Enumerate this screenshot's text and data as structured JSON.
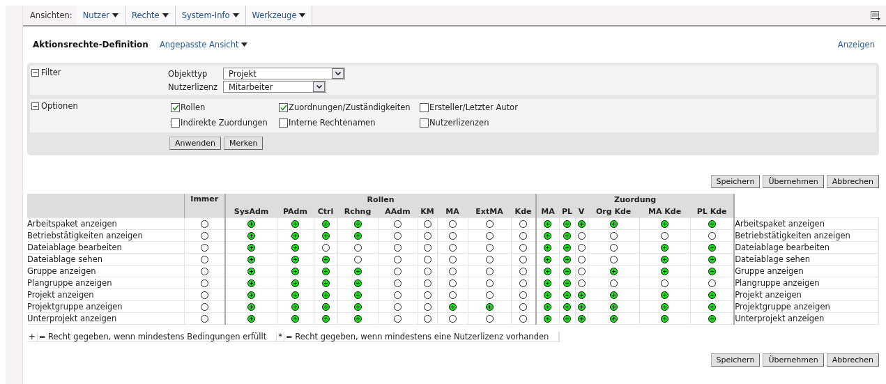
{
  "menu": {
    "label": "Ansichten:",
    "items": [
      "Nutzer",
      "Rechte",
      "System-Info",
      "Werkzeuge"
    ]
  },
  "header": {
    "title": "Aktionsrechte-Definition",
    "view": "Angepasste Ansicht",
    "action": "Anzeigen"
  },
  "filter": {
    "title": "Filter",
    "expanded": true,
    "fields": [
      {
        "label": "Objekttyp",
        "value": "Projekt"
      },
      {
        "label": "Nutzerlizenz",
        "value": "Mitarbeiter"
      }
    ]
  },
  "options": {
    "title": "Optionen",
    "expanded": true,
    "items": [
      {
        "label": "Rollen",
        "checked": true
      },
      {
        "label": "Zuordnungen/Zuständigkeiten",
        "checked": true
      },
      {
        "label": "Ersteller/Letzter Autor",
        "checked": false
      },
      {
        "label": "Indirekte Zuordungen",
        "checked": false
      },
      {
        "label": "Interne Rechtenamen",
        "checked": false
      },
      {
        "label": "Nutzerlizenzen",
        "checked": false
      }
    ]
  },
  "filter_buttons": [
    "Anwenden",
    "Merken"
  ],
  "actions_top": [
    "Speichern",
    "Übernehmen",
    "Abbrechen"
  ],
  "table": {
    "single_columns": [
      "Immer"
    ],
    "groups": [
      {
        "label": "Rollen",
        "columns": [
          "SysAdm",
          "PAdm",
          "Ctrl",
          "Rchng",
          "AAdm",
          "KM",
          "MA",
          "ExtMA",
          "Kde"
        ]
      },
      {
        "label": "Zuordung",
        "columns": [
          "MA",
          "PL",
          "V",
          "Org Kde",
          "MA Kde",
          "PL Kde"
        ]
      }
    ],
    "rows": [
      {
        "label": "Arbeitspaket anzeigen",
        "cells": [
          false,
          true,
          true,
          true,
          true,
          false,
          false,
          false,
          false,
          false,
          true,
          true,
          true,
          true,
          true,
          true
        ],
        "label_repeat": "Arbeitspaket anzeigen"
      },
      {
        "label": "Betriebstätigkeiten anzeigen",
        "cells": [
          false,
          true,
          true,
          true,
          true,
          false,
          false,
          false,
          false,
          false,
          true,
          true,
          false,
          false,
          false,
          false
        ],
        "label_repeat": "Betriebstätigkeiten anzeigen"
      },
      {
        "label": "Dateiablage bearbeiten",
        "cells": [
          false,
          true,
          true,
          false,
          false,
          false,
          false,
          false,
          false,
          false,
          true,
          true,
          false,
          false,
          true,
          true
        ],
        "label_repeat": "Dateiablage bearbeiten"
      },
      {
        "label": "Dateiablage sehen",
        "cells": [
          false,
          true,
          true,
          true,
          false,
          false,
          false,
          false,
          false,
          false,
          true,
          true,
          false,
          false,
          true,
          true
        ],
        "label_repeat": "Dateiablage sehen"
      },
      {
        "label": "Gruppe anzeigen",
        "cells": [
          false,
          true,
          true,
          true,
          true,
          false,
          false,
          false,
          false,
          false,
          true,
          true,
          false,
          true,
          true,
          true
        ],
        "label_repeat": "Gruppe anzeigen"
      },
      {
        "label": "Plangruppe anzeigen",
        "cells": [
          false,
          true,
          true,
          true,
          true,
          false,
          false,
          false,
          false,
          false,
          true,
          true,
          false,
          false,
          false,
          false
        ],
        "label_repeat": "Plangruppe anzeigen"
      },
      {
        "label": "Projekt anzeigen",
        "cells": [
          false,
          true,
          true,
          true,
          true,
          false,
          false,
          false,
          false,
          false,
          true,
          true,
          true,
          true,
          true,
          true
        ],
        "label_repeat": "Projekt anzeigen"
      },
      {
        "label": "Projektgruppe anzeigen",
        "cells": [
          false,
          true,
          true,
          true,
          true,
          false,
          false,
          true,
          true,
          false,
          true,
          true,
          true,
          true,
          true,
          true
        ],
        "label_repeat": "Projektgruppe anzeigen"
      },
      {
        "label": "Unterprojekt anzeigen",
        "cells": [
          false,
          true,
          true,
          true,
          true,
          false,
          false,
          false,
          false,
          false,
          true,
          true,
          true,
          true,
          true,
          true
        ],
        "label_repeat": "Unterprojekt anzeigen"
      }
    ]
  },
  "legend": [
    {
      "symbol": "+",
      "text": "= Recht gegeben, wenn mindestens Bedingungen erfüllt"
    },
    {
      "symbol": "*",
      "text": "= Recht gegeben, wenn mindestens eine Nutzerlizenz vorhanden"
    }
  ],
  "actions_bottom": [
    "Speichern",
    "Übernehmen",
    "Abbrechen"
  ]
}
